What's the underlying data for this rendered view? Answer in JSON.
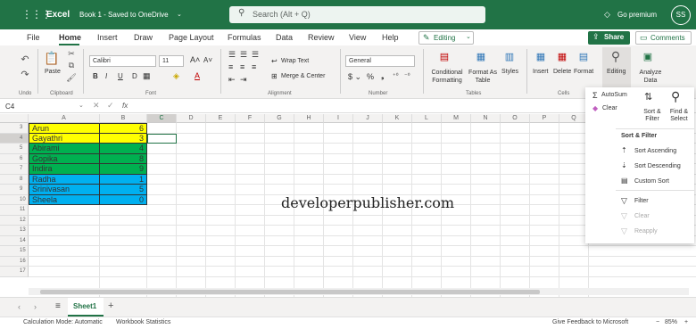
{
  "titlebar": {
    "app": "Excel",
    "doc": "Book 1 - Saved to OneDrive",
    "search_placeholder": "Search (Alt + Q)",
    "premium": "Go premium",
    "avatar": "SS"
  },
  "menu": {
    "tabs": [
      "File",
      "Home",
      "Insert",
      "Draw",
      "Page Layout",
      "Formulas",
      "Data",
      "Review",
      "View",
      "Help"
    ],
    "editing": "Editing",
    "share": "Share",
    "comments": "Comments"
  },
  "ribbon": {
    "paste": "Paste",
    "font_name": "Calibri",
    "font_size": "11",
    "wrap_text": "Wrap Text",
    "merge_center": "Merge & Center",
    "number_format": "General",
    "conditional_formatting": "Conditional Formatting",
    "format_as_table": "Format As Table",
    "styles": "Styles",
    "insert": "Insert",
    "delete": "Delete",
    "format": "Format",
    "editing": "Editing",
    "analyze_data": "Analyze Data",
    "groups": {
      "undo": "Undo",
      "clipboard": "Clipboard",
      "font": "Font",
      "alignment": "Alignment",
      "number": "Number",
      "tables": "Tables",
      "cells": "Cells"
    }
  },
  "formula_bar": {
    "cell_ref": "C4",
    "fx": "fx"
  },
  "grid": {
    "columns": [
      "A",
      "B",
      "C",
      "D",
      "E",
      "F",
      "G",
      "H",
      "I",
      "J",
      "K",
      "L",
      "M",
      "N",
      "O",
      "P",
      "Q"
    ],
    "rows": [
      "3",
      "4",
      "5",
      "6",
      "7",
      "8",
      "9",
      "10",
      "11",
      "12",
      "13",
      "14",
      "15",
      "16",
      "17"
    ],
    "data": [
      {
        "name": "Arun",
        "value": "6",
        "color": "#ffff00"
      },
      {
        "name": "Gayathri",
        "value": "3",
        "color": "#ffff00"
      },
      {
        "name": "Abirami",
        "value": "4",
        "color": "#00b050"
      },
      {
        "name": "Gopika",
        "value": "8",
        "color": "#00b050"
      },
      {
        "name": "Indira",
        "value": "9",
        "color": "#00b050"
      },
      {
        "name": "Radha",
        "value": "1",
        "color": "#00b0f0"
      },
      {
        "name": "Srinivasan",
        "value": "5",
        "color": "#00b0f0"
      },
      {
        "name": "Sheela",
        "value": "0",
        "color": "#00b0f0"
      }
    ]
  },
  "dropdown": {
    "autosum": "AutoSum",
    "clear": "Clear",
    "sort_filter": "Sort & Filter",
    "find_select": "Find & Select",
    "heading": "Sort & Filter",
    "sort_ascending": "Sort Ascending",
    "sort_descending": "Sort Descending",
    "custom_sort": "Custom Sort",
    "filter": "Filter",
    "clear_item": "Clear",
    "reapply": "Reapply"
  },
  "watermark": "developerpublisher.com",
  "sheets": {
    "active": "Sheet1"
  },
  "status": {
    "calc_mode": "Calculation Mode: Automatic",
    "workbook_stats": "Workbook Statistics",
    "feedback": "Give Feedback to Microsoft",
    "zoom": "85%"
  },
  "colors": {
    "brand": "#217346"
  }
}
